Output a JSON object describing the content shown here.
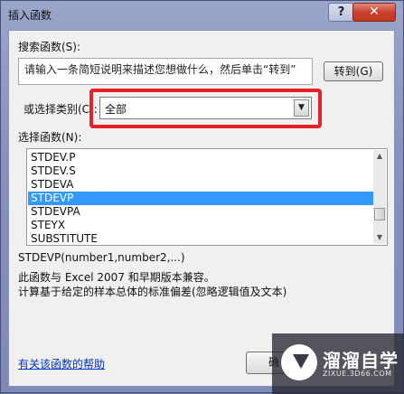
{
  "window": {
    "title": "插入函数",
    "help_symbol": "?",
    "close_symbol": "✕"
  },
  "search": {
    "label": "搜索函数(S):",
    "text": "请输入一条简短说明来描述您想做什么，然后单击“转到”",
    "go_button": "转到(G)"
  },
  "category": {
    "label": "或选择类别(C):",
    "value": "全部"
  },
  "functions": {
    "label": "选择函数(N):",
    "items": [
      "STDEV.P",
      "STDEV.S",
      "STDEVA",
      "STDEVP",
      "STDEVPA",
      "STEYX",
      "SUBSTITUTE"
    ],
    "selected": "STDEVP"
  },
  "details": {
    "syntax": "STDEVP(number1,number2,...)",
    "compat": "此函数与 Excel 2007 和早期版本兼容。",
    "description": "计算基于给定的样本总体的标准偏差(忽略逻辑值及文本)"
  },
  "help_link": "有关该函数的帮助",
  "ok_button_partial": "确",
  "watermark": {
    "title": "溜溜自学",
    "subtitle": "ZIXUE.3D66.COM"
  },
  "colors": {
    "highlight": "#e3222a",
    "selection": "#3399ff",
    "link": "#0033cc"
  }
}
